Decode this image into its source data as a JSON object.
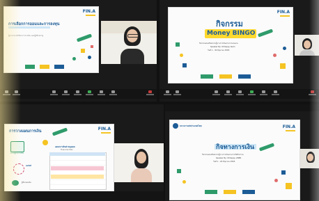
{
  "brand_logo": "FIN.A",
  "top_left_slide": {
    "heading": "การเลือกการออมและการลงทุน",
    "subtext": "ผู้บรรยาย นักวิชาการการเงิน และผู้เชี่ยวชาญ"
  },
  "top_right_slide": {
    "title_line1": "กิจกรรม",
    "title_line2": "Money BINGO",
    "desc_line1": "กิจกรรมส่งเสริมความรู้ทางการเงินผ่านการเล่นเกม",
    "desc_line2": "Speaker By: Ohhappy team",
    "desc_line3": "วันที่ 1 - 30 มิถุนายน 2565"
  },
  "bottom_left_slide": {
    "heading": "การวางแผนการเงิน",
    "box1_label": "ความรู้ทางการเงิน",
    "box2_label": "ผลลัพธ์",
    "box3_label": "รู้ที่มาของเงิน",
    "mid_title": "แผนการเงินส่วนบุคคล",
    "mid_sub": "Financial Plan"
  },
  "bottom_right_slide": {
    "org_name": "ธนาคารแห่งประเทศไทย",
    "title": "กิจทางการเงิน",
    "desc_line1": "กิจกรรมส่งเสริมความรู้ทางการเงินผ่านการจัดกิจกรรม",
    "desc_line2": "Speaker By: Ohhappy LINER",
    "desc_line3": "วันที่ 1 - 20 มิถุนายน 2565"
  },
  "toolbar_items": [
    "Mute",
    "Video",
    "Security",
    "Participants",
    "Chat",
    "Share",
    "Record",
    "Reactions",
    "Apps",
    "End"
  ],
  "colors": {
    "accent_blue": "#1c5c96",
    "accent_green": "#2f9b6b",
    "accent_yellow": "#f5c423",
    "bingo_bg": "#ffd92e",
    "end_red": "#c63a3a"
  }
}
